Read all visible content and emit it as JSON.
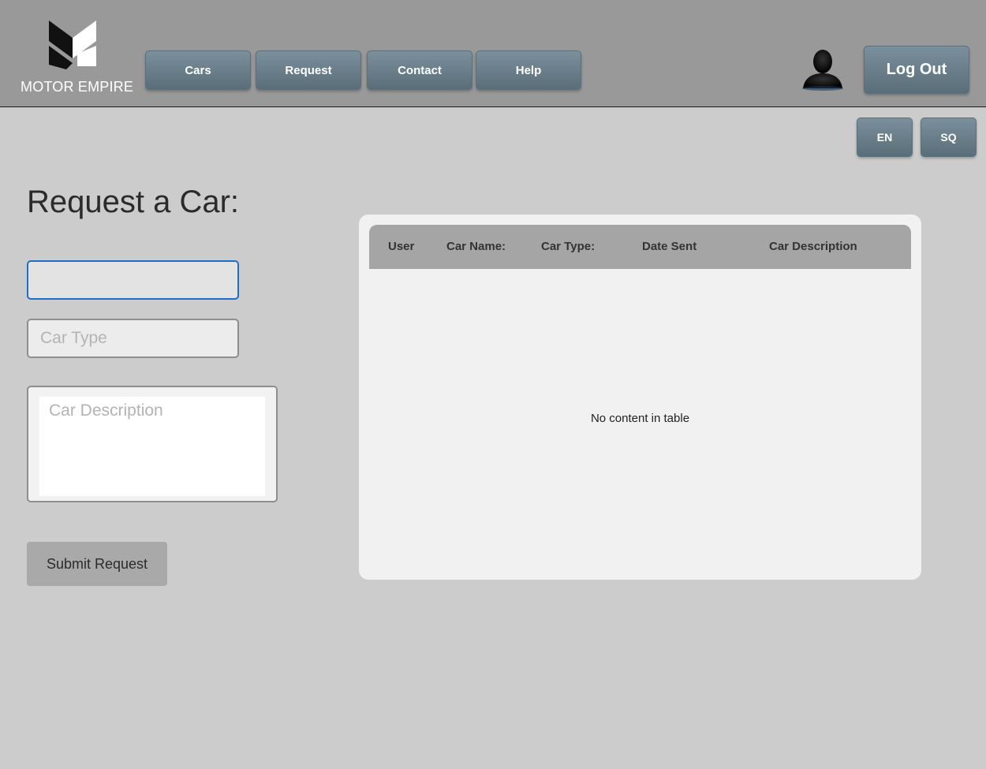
{
  "brand": {
    "name": "MOTOR EMPIRE",
    "logo_icon": "motor-empire-m-logo"
  },
  "nav": {
    "items": [
      {
        "label": "Cars"
      },
      {
        "label": "Request"
      },
      {
        "label": "Contact"
      },
      {
        "label": "Help"
      }
    ]
  },
  "user": {
    "avatar_icon": "user-avatar-icon",
    "logout_label": "Log Out"
  },
  "language": {
    "options": [
      {
        "label": "EN"
      },
      {
        "label": "SQ"
      }
    ]
  },
  "form": {
    "title": "Request a Car:",
    "car_name": {
      "value": "",
      "placeholder": ""
    },
    "car_type": {
      "value": "",
      "placeholder": "Car Type"
    },
    "car_description": {
      "value": "",
      "placeholder": "Car Description"
    },
    "submit_label": "Submit Request"
  },
  "table": {
    "columns": [
      "User",
      "Car Name:",
      "Car Type:",
      "Date Sent",
      "Car Description"
    ],
    "rows": [],
    "empty_message": "No content in table"
  },
  "colors": {
    "header_bg": "#999999",
    "page_bg": "#cccccc",
    "button_gradient_top": "#7a909c",
    "button_gradient_bottom": "#5a6e79",
    "focus_border": "#1f6ec8"
  }
}
